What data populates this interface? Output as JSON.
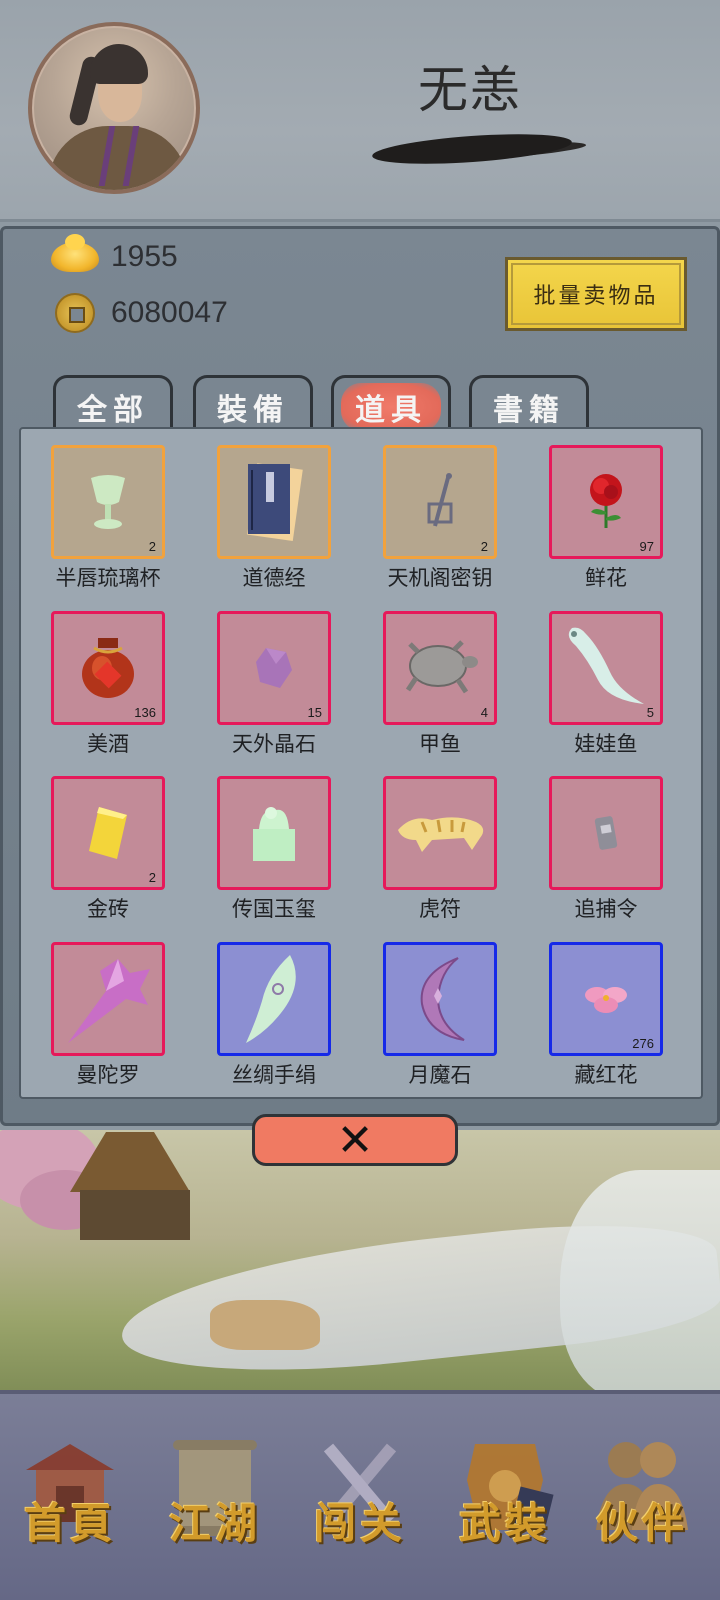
{
  "player": {
    "name": "无恙"
  },
  "currency": {
    "ingots": "1955",
    "coins": "6080047"
  },
  "actions": {
    "bulk_sell_label": "批量卖物品"
  },
  "tabs": [
    {
      "label": "全部",
      "active": false
    },
    {
      "label": "裝備",
      "active": false
    },
    {
      "label": "道具",
      "active": true
    },
    {
      "label": "書籍",
      "active": false
    }
  ],
  "items": [
    {
      "name": "半唇琉璃杯",
      "count": "2",
      "rarity": "orange",
      "icon": "jade-cup-icon"
    },
    {
      "name": "道德经",
      "count": "",
      "rarity": "orange",
      "icon": "book-icon"
    },
    {
      "name": "天机阁密钥",
      "count": "2",
      "rarity": "orange",
      "icon": "key-icon"
    },
    {
      "name": "鲜花",
      "count": "97",
      "rarity": "purple",
      "icon": "rose-icon"
    },
    {
      "name": "美酒",
      "count": "136",
      "rarity": "purple",
      "icon": "wine-jar-icon"
    },
    {
      "name": "天外晶石",
      "count": "15",
      "rarity": "purple",
      "icon": "crystal-icon"
    },
    {
      "name": "甲鱼",
      "count": "4",
      "rarity": "purple",
      "icon": "turtle-icon"
    },
    {
      "name": "娃娃鱼",
      "count": "5",
      "rarity": "purple",
      "icon": "salamander-icon"
    },
    {
      "name": "金砖",
      "count": "2",
      "rarity": "purple",
      "icon": "gold-brick-icon"
    },
    {
      "name": "传国玉玺",
      "count": "",
      "rarity": "purple",
      "icon": "jade-seal-icon"
    },
    {
      "name": "虎符",
      "count": "",
      "rarity": "purple",
      "icon": "tiger-tally-icon"
    },
    {
      "name": "追捕令",
      "count": "",
      "rarity": "purple",
      "icon": "warrant-icon"
    },
    {
      "name": "曼陀罗",
      "count": "",
      "rarity": "purple",
      "icon": "datura-icon"
    },
    {
      "name": "丝绸手绢",
      "count": "",
      "rarity": "blue",
      "icon": "silk-icon"
    },
    {
      "name": "月魔石",
      "count": "",
      "rarity": "blue",
      "icon": "moon-stone-icon"
    },
    {
      "name": "藏红花",
      "count": "276",
      "rarity": "blue",
      "icon": "saffron-icon"
    }
  ],
  "close": {
    "label": "✕"
  },
  "nav": [
    {
      "label": "首頁",
      "icon": "pavilion-icon"
    },
    {
      "label": "江湖",
      "icon": "scroll-icon"
    },
    {
      "label": "闯关",
      "icon": "crossed-swords-icon"
    },
    {
      "label": "武裝",
      "icon": "armor-icon"
    },
    {
      "label": "伙伴",
      "icon": "companions-icon"
    }
  ],
  "colors": {
    "rarity_orange": "#f2a23c",
    "rarity_purple": "#e6195a",
    "rarity_blue": "#1629e8",
    "active_tab": "#e36a5a",
    "nav_label": "#d29b2b"
  }
}
